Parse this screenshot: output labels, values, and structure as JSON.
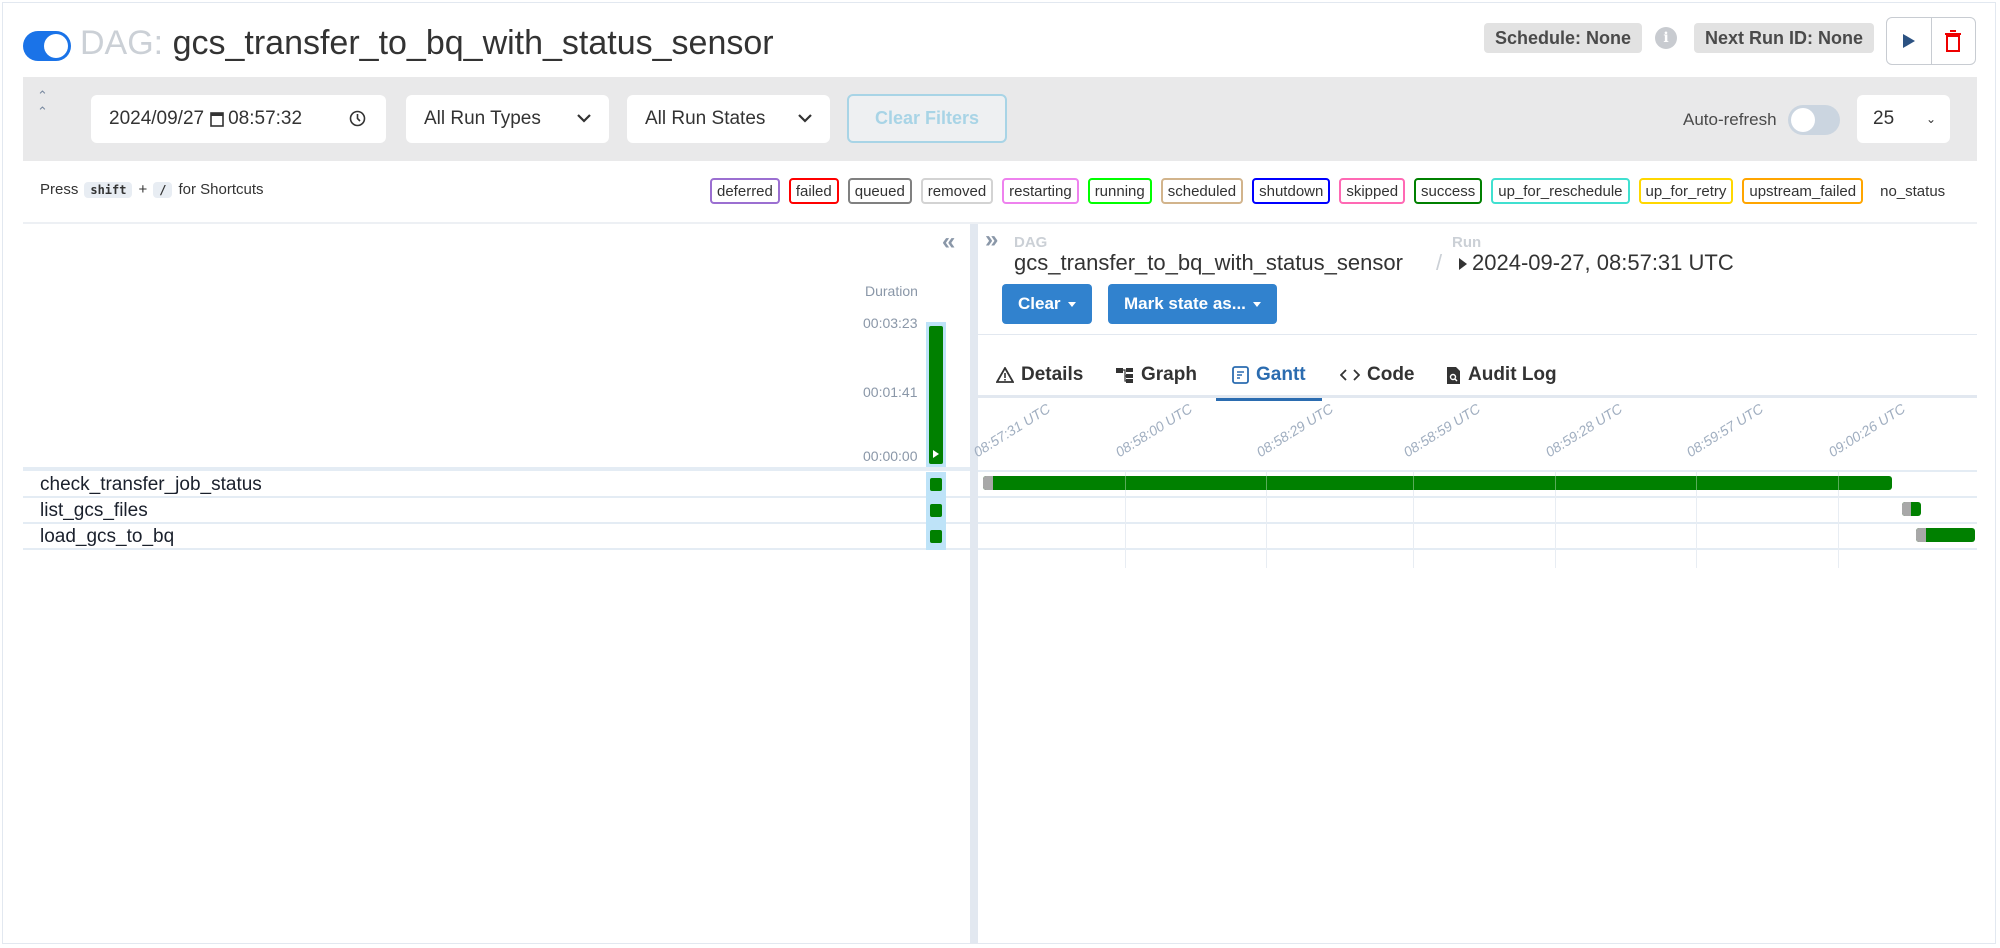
{
  "header": {
    "dag_prefix": "DAG:",
    "dag_id": "gcs_transfer_to_bq_with_status_sensor",
    "dag_paused_toggle": "on",
    "schedule_badge": "Schedule: None",
    "next_run_badge": "Next Run ID: None",
    "info_icon": "info-icon",
    "trigger_icon": "play-icon",
    "delete_icon": "trash-icon"
  },
  "filters": {
    "date_value": "2024/09/27",
    "time_value": "08:57:32",
    "run_type": "All Run Types",
    "run_state": "All Run States",
    "clear_label": "Clear Filters",
    "auto_refresh_label": "Auto-refresh",
    "auto_refresh_on": false,
    "page_size": "25"
  },
  "shortcuts": {
    "press": "Press",
    "key1": "shift",
    "plus": "+",
    "key2": "/",
    "suffix": "for Shortcuts"
  },
  "legend": [
    {
      "label": "deferred",
      "color": "#9b6fd1"
    },
    {
      "label": "failed",
      "color": "#ff0000"
    },
    {
      "label": "queued",
      "color": "#808080"
    },
    {
      "label": "removed",
      "color": "#d3d3d3"
    },
    {
      "label": "restarting",
      "color": "#ee82ee"
    },
    {
      "label": "running",
      "color": "#00ff00"
    },
    {
      "label": "scheduled",
      "color": "#d2b48c"
    },
    {
      "label": "shutdown",
      "color": "#0000ff"
    },
    {
      "label": "skipped",
      "color": "#ff69b4"
    },
    {
      "label": "success",
      "color": "#008000"
    },
    {
      "label": "up_for_reschedule",
      "color": "#40e0d0"
    },
    {
      "label": "up_for_retry",
      "color": "#ffd700"
    },
    {
      "label": "upstream_failed",
      "color": "#ffa500"
    },
    {
      "label": "no_status",
      "color": ""
    }
  ],
  "grid": {
    "duration_label": "Duration",
    "duration_ticks": [
      "00:03:23",
      "00:01:41",
      "00:00:00"
    ],
    "run_duration_fraction": 1.0,
    "run_state": "success",
    "tasks": [
      {
        "name": "check_transfer_job_status",
        "state": "success"
      },
      {
        "name": "list_gcs_files",
        "state": "success"
      },
      {
        "name": "load_gcs_to_bq",
        "state": "success"
      }
    ]
  },
  "details": {
    "dag_label": "DAG",
    "dag_value": "gcs_transfer_to_bq_with_status_sensor",
    "separator": "/",
    "run_label": "Run",
    "run_value": "2024-09-27, 08:57:31 UTC",
    "clear_button": "Clear",
    "mark_state_button": "Mark state as...",
    "tabs": [
      {
        "label": "Details",
        "icon": "warning-triangle-icon",
        "active": false
      },
      {
        "label": "Graph",
        "icon": "graph-icon",
        "active": false
      },
      {
        "label": "Gantt",
        "icon": "gantt-icon",
        "active": true
      },
      {
        "label": "Code",
        "icon": "code-icon",
        "active": false
      },
      {
        "label": "Audit Log",
        "icon": "audit-file-icon",
        "active": false
      }
    ]
  },
  "gantt": {
    "ticks": [
      "08:57:31 UTC",
      "08:58:00 UTC",
      "08:58:29 UTC",
      "08:58:59 UTC",
      "08:59:28 UTC",
      "08:59:57 UTC",
      "09:00:26 UTC"
    ],
    "tick_seconds": [
      0,
      29,
      58,
      88,
      117,
      146,
      175
    ],
    "range_seconds": [
      0,
      203
    ],
    "bars": [
      {
        "task": "check_transfer_job_status",
        "queued_start": 0,
        "start": 2,
        "end": 186,
        "state": "success"
      },
      {
        "task": "list_gcs_files",
        "queued_start": 188,
        "start": 190,
        "end": 192,
        "state": "success"
      },
      {
        "task": "load_gcs_to_bq",
        "queued_start": 191,
        "start": 193,
        "end": 203,
        "state": "success"
      }
    ]
  }
}
